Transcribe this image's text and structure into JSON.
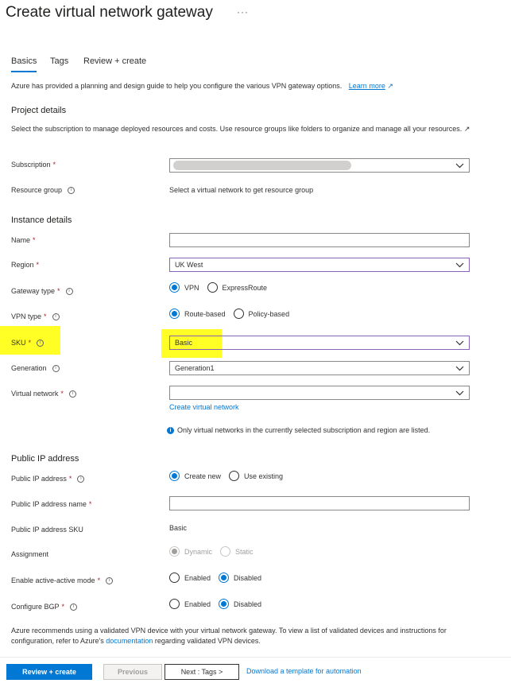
{
  "page": {
    "title": "Create virtual network gateway",
    "more_label": "···"
  },
  "tabs": [
    {
      "label": "Basics"
    },
    {
      "label": "Tags"
    },
    {
      "label": "Review + create"
    }
  ],
  "intro": {
    "text": "Azure has provided a planning and design guide to help you configure the various VPN gateway options.",
    "link": "Learn more"
  },
  "project": {
    "heading": "Project details",
    "description": "Select the subscription to manage deployed resources and costs. Use resource groups like folders to organize and manage all your resources.",
    "subscription_label": "Subscription",
    "resource_group_label": "Resource group",
    "resource_group_value": "Select a virtual network to get resource group"
  },
  "instance": {
    "heading": "Instance details",
    "name_label": "Name",
    "name_value": "",
    "region_label": "Region",
    "region_value": "UK West",
    "gateway_type_label": "Gateway type",
    "gateway_type_options": [
      "VPN",
      "ExpressRoute"
    ],
    "vpn_type_label": "VPN type",
    "vpn_type_options": [
      "Route-based",
      "Policy-based"
    ],
    "sku_label": "SKU",
    "sku_value": "Basic",
    "generation_label": "Generation",
    "generation_value": "Generation1",
    "vnet_label": "Virtual network",
    "vnet_value": "",
    "create_vnet_link": "Create virtual network",
    "vnet_note": "Only virtual networks in the currently selected subscription and region are listed."
  },
  "public_ip": {
    "heading": "Public IP address",
    "address_label": "Public IP address",
    "address_options": [
      "Create new",
      "Use existing"
    ],
    "name_label": "Public IP address name",
    "name_value": "",
    "sku_label": "Public IP address SKU",
    "sku_value": "Basic",
    "assignment_label": "Assignment",
    "assignment_options": [
      "Dynamic",
      "Static"
    ],
    "active_label": "Enable active-active mode",
    "active_options": [
      "Enabled",
      "Disabled"
    ],
    "bgp_label": "Configure BGP",
    "bgp_options": [
      "Enabled",
      "Disabled"
    ]
  },
  "footer": {
    "text_before": "Azure recommends using a validated VPN device with your virtual network gateway. To view a list of validated devices and instructions for configuration, refer to Azure's",
    "doc_link": "documentation",
    "text_after": "regarding validated VPN devices.",
    "review_button": "Review + create",
    "previous_button": "Previous",
    "next_button": "Next : Tags >",
    "download_link": "Download a template for automation"
  },
  "colors": {
    "accent": "#0078d4",
    "highlight": "#ffff00",
    "required": "#a4262c"
  }
}
